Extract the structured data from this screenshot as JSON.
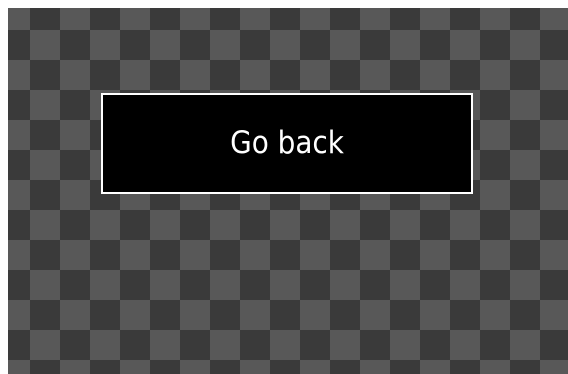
{
  "dialog": {
    "button_label": "Go back"
  },
  "colors": {
    "button_background": "#000000",
    "button_border": "#ffffff",
    "button_text": "#ffffff",
    "checker_dark": "#3a3a3a",
    "checker_light": "#585858"
  }
}
